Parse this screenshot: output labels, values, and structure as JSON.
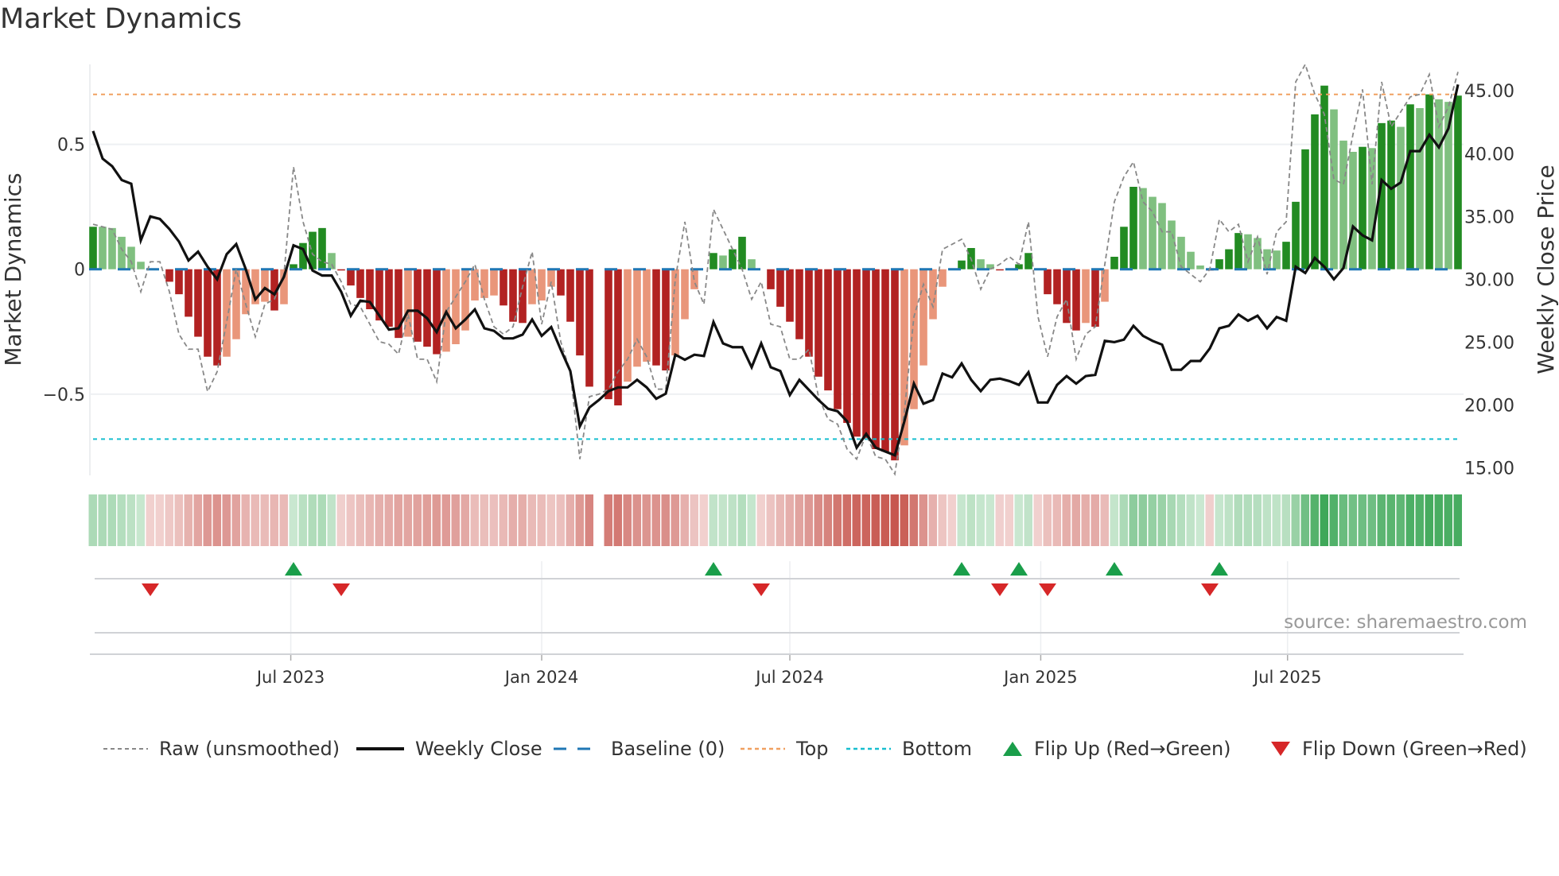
{
  "title": "Market Dynamics",
  "source": "source: sharemaestro.com",
  "legend": {
    "raw": "Raw (unsmoothed)",
    "close": "Weekly Close",
    "baseline": "Baseline (0)",
    "top": "Top",
    "bottom": "Bottom",
    "flip_up": "Flip Up (Red→Green)",
    "flip_down": "Flip Down (Green→Red)"
  },
  "colors": {
    "dark_green": "#228b22",
    "light_green": "#80c080",
    "dark_red": "#b22222",
    "light_red": "#e9967a",
    "baseline": "#1f77b4",
    "top": "#f0a060",
    "bottom": "#17becf",
    "raw": "#888888",
    "close": "#111111",
    "flip_up": "#1a9e4a",
    "flip_down": "#d62728"
  },
  "chart_data": {
    "type": "bar",
    "title": "Market Dynamics",
    "ylabel": "Market Dynamics",
    "ylabel_right": "Weekly Close Price",
    "frequency": "weekly",
    "start_week": "2023-02-06",
    "ylim": [
      -0.825,
      0.82
    ],
    "ylim_right": [
      14.4,
      47.1
    ],
    "yticks": [
      {
        "v": 0.5,
        "label": "0.5"
      },
      {
        "v": 0,
        "label": "0"
      },
      {
        "v": -0.5,
        "label": "−0.5"
      }
    ],
    "yticks_right": [
      {
        "v": 45,
        "label": "45.00"
      },
      {
        "v": 40,
        "label": "40.00"
      },
      {
        "v": 35,
        "label": "35.00"
      },
      {
        "v": 30,
        "label": "30.00"
      },
      {
        "v": 25,
        "label": "25.00"
      },
      {
        "v": 20,
        "label": "20.00"
      },
      {
        "v": 15,
        "label": "15.00"
      }
    ],
    "xticks": [
      {
        "date": "2023-07-01",
        "label": "Jul 2023"
      },
      {
        "date": "2024-01-01",
        "label": "Jan 2024"
      },
      {
        "date": "2024-07-01",
        "label": "Jul 2024"
      },
      {
        "date": "2025-01-01",
        "label": "Jan 2025"
      },
      {
        "date": "2025-07-01",
        "label": "Jul 2025"
      }
    ],
    "top_threshold": 0.7,
    "bottom_threshold": -0.68,
    "baseline": 0,
    "values": [
      0.17,
      0.17,
      0.165,
      0.13,
      0.09,
      0.03,
      0,
      0,
      -0.05,
      -0.1,
      -0.19,
      -0.27,
      -0.35,
      -0.385,
      -0.35,
      -0.28,
      -0.18,
      -0.14,
      -0.13,
      -0.165,
      -0.14,
      0.02,
      0.105,
      0.15,
      0.165,
      0.065,
      -0.005,
      -0.065,
      -0.115,
      -0.16,
      -0.205,
      -0.23,
      -0.275,
      -0.27,
      -0.29,
      -0.31,
      -0.34,
      -0.33,
      -0.3,
      -0.245,
      -0.125,
      -0.115,
      -0.105,
      -0.145,
      -0.21,
      -0.215,
      -0.14,
      -0.125,
      -0.07,
      -0.105,
      -0.21,
      -0.345,
      -0.47,
      null,
      -0.52,
      -0.545,
      -0.45,
      -0.39,
      -0.37,
      -0.385,
      -0.405,
      -0.345,
      -0.2,
      -0.08,
      0,
      0.065,
      0.055,
      0.08,
      0.13,
      0.04,
      0,
      -0.08,
      -0.15,
      -0.21,
      -0.28,
      -0.35,
      -0.43,
      -0.485,
      -0.56,
      -0.615,
      -0.67,
      -0.675,
      -0.72,
      -0.73,
      -0.765,
      -0.705,
      -0.56,
      -0.385,
      -0.2,
      -0.07,
      0,
      0.035,
      0.085,
      0.04,
      0.02,
      -0.003,
      0,
      0.02,
      0.065,
      0,
      -0.1,
      -0.14,
      -0.215,
      -0.245,
      -0.215,
      -0.23,
      -0.13,
      0.05,
      0.17,
      0.33,
      0.325,
      0.29,
      0.265,
      0.195,
      0.13,
      0.07,
      0.015,
      -0.005,
      0.04,
      0.08,
      0.145,
      0.14,
      0.125,
      0.08,
      0.075,
      0.11,
      0.27,
      0.48,
      0.62,
      0.735,
      0.64,
      0.515,
      0.47,
      0.49,
      0.485,
      0.585,
      0.595,
      0.57,
      0.66,
      0.645,
      0.7,
      0.68,
      0.67,
      0.695
    ],
    "raw": [
      0.18,
      0.17,
      0.16,
      0.08,
      0.03,
      -0.09,
      0.03,
      0.03,
      -0.09,
      -0.26,
      -0.32,
      -0.32,
      -0.49,
      -0.41,
      -0.21,
      0,
      -0.14,
      -0.27,
      -0.14,
      -0.12,
      -0.02,
      0.41,
      0.19,
      0.06,
      0.03,
      0.02,
      -0.05,
      -0.14,
      -0.15,
      -0.22,
      -0.29,
      -0.3,
      -0.34,
      -0.18,
      -0.36,
      -0.36,
      -0.45,
      -0.17,
      -0.11,
      -0.05,
      0.02,
      -0.12,
      -0.23,
      -0.26,
      -0.23,
      -0.07,
      0.07,
      -0.22,
      -0.05,
      -0.29,
      -0.41,
      -0.76,
      -0.51,
      -0.5,
      -0.48,
      -0.41,
      -0.36,
      -0.28,
      -0.35,
      -0.48,
      -0.48,
      -0.04,
      0.19,
      -0.05,
      -0.14,
      0.24,
      0.16,
      0.08,
      0,
      -0.12,
      -0.05,
      -0.22,
      -0.23,
      -0.36,
      -0.36,
      -0.32,
      -0.51,
      -0.6,
      -0.62,
      -0.72,
      -0.76,
      -0.66,
      -0.75,
      -0.76,
      -0.82,
      -0.57,
      -0.19,
      -0.06,
      -0.15,
      0.08,
      0.1,
      0.12,
      0.04,
      -0.08,
      0,
      0.02,
      0.05,
      0.02,
      0.19,
      -0.19,
      -0.35,
      -0.19,
      -0.12,
      -0.36,
      -0.26,
      -0.23,
      0.02,
      0.27,
      0.37,
      0.43,
      0.27,
      0.23,
      0.15,
      0.15,
      0.01,
      -0.02,
      -0.05,
      0,
      0.2,
      0.15,
      0.18,
      0.03,
      0.13,
      -0.02,
      0.15,
      0.19,
      0.75,
      0.82,
      0.7,
      0.62,
      0.36,
      0.34,
      0.54,
      0.72,
      0.34,
      0.75,
      0.57,
      0.63,
      0.69,
      0.7,
      0.78,
      0.57,
      0.65,
      0.79
    ],
    "close": [
      41.8,
      39.6,
      39.0,
      37.9,
      37.6,
      33.1,
      35.0,
      34.8,
      34.0,
      33.0,
      31.5,
      32.2,
      31.0,
      30.0,
      32.0,
      32.8,
      30.8,
      28.4,
      29.3,
      28.8,
      30.2,
      32.7,
      32.4,
      30.7,
      30.3,
      30.3,
      29.0,
      27.1,
      28.3,
      28.2,
      27.1,
      26.0,
      26.1,
      27.5,
      27.5,
      26.9,
      25.8,
      27.4,
      26.1,
      26.8,
      27.6,
      26.1,
      25.9,
      25.3,
      25.3,
      25.6,
      26.8,
      25.5,
      26.2,
      24.4,
      22.7,
      18.3,
      19.8,
      20.4,
      21.1,
      21.4,
      21.4,
      22.0,
      21.4,
      20.5,
      20.9,
      24.0,
      23.6,
      24.0,
      23.9,
      26.6,
      24.9,
      24.6,
      24.6,
      23.0,
      24.9,
      23.0,
      22.7,
      20.8,
      22.0,
      21.2,
      20.4,
      19.7,
      19.5,
      18.7,
      16.6,
      17.7,
      16.6,
      16.3,
      16.0,
      18.7,
      21.7,
      20.1,
      20.4,
      22.5,
      22.2,
      23.3,
      22.0,
      21.1,
      22.0,
      22.1,
      21.9,
      21.6,
      22.6,
      20.2,
      20.2,
      21.6,
      22.3,
      21.7,
      22.3,
      22.4,
      25.1,
      25.0,
      25.2,
      26.3,
      25.5,
      25.1,
      24.8,
      22.8,
      22.8,
      23.5,
      23.5,
      24.5,
      26.1,
      26.3,
      27.2,
      26.7,
      27.1,
      26.1,
      27.0,
      26.7,
      31.0,
      30.5,
      31.7,
      31.0,
      30.0,
      30.9,
      34.2,
      33.5,
      33.1,
      37.9,
      37.2,
      37.7,
      40.2,
      40.2,
      41.5,
      40.5,
      42.0,
      45.5
    ],
    "flip_up_weeks": [
      22,
      66,
      92,
      98,
      108,
      119
    ],
    "flip_down_weeks": [
      7,
      27,
      71,
      96,
      101,
      118
    ]
  }
}
